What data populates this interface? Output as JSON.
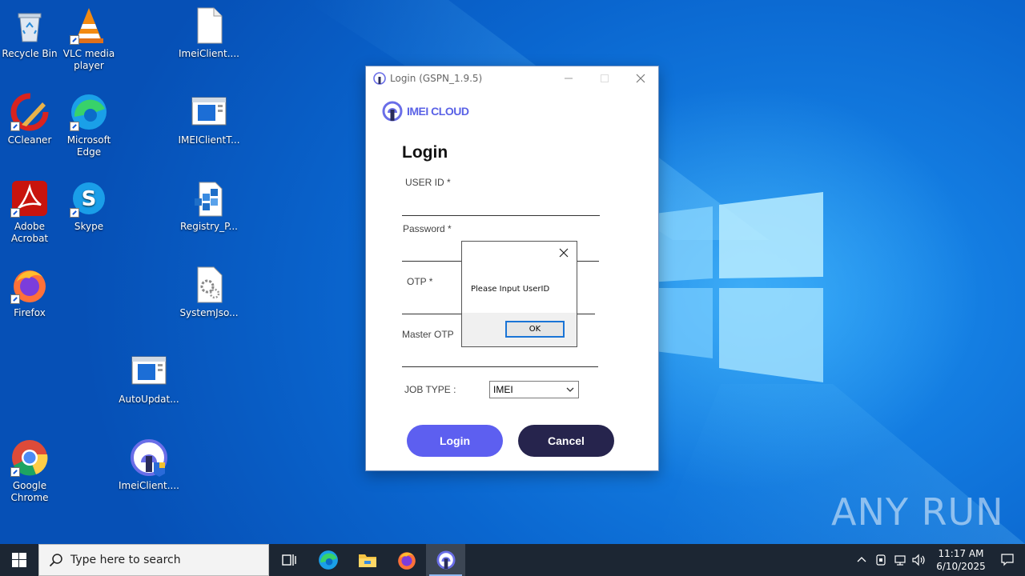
{
  "desktop": {
    "icons": [
      {
        "label": "Recycle Bin",
        "icon": "recycle-bin-icon"
      },
      {
        "label": "VLC media player",
        "icon": "vlc-icon"
      },
      {
        "label": "ImeiClient....",
        "icon": "file-icon"
      },
      {
        "label": "CCleaner",
        "icon": "ccleaner-icon"
      },
      {
        "label": "Microsoft Edge",
        "icon": "edge-icon"
      },
      {
        "label": "IMEIClientT...",
        "icon": "window-app-icon"
      },
      {
        "label": "Adobe Acrobat",
        "icon": "acrobat-icon"
      },
      {
        "label": "Skype",
        "icon": "skype-icon"
      },
      {
        "label": "Registry_P...",
        "icon": "registry-icon"
      },
      {
        "label": "Firefox",
        "icon": "firefox-icon"
      },
      {
        "label": "SystemJso...",
        "icon": "settings-file-icon"
      },
      {
        "label": "AutoUpdat...",
        "icon": "window-app-icon"
      },
      {
        "label": "Google Chrome",
        "icon": "chrome-icon"
      },
      {
        "label": "ImeiClient....",
        "icon": "imei-cloud-icon"
      }
    ],
    "watermark": "ANY RUN"
  },
  "login_window": {
    "title": "Login (GSPN_1.9.5)",
    "brand": "IMEI CLOUD",
    "heading": "Login",
    "fields": {
      "user_id_label": "USER ID *",
      "password_label": "Password *",
      "otp_label": "OTP *",
      "master_otp_label": "Master OTP"
    },
    "job_type_label": "JOB TYPE :",
    "job_type_value": "IMEI",
    "login_button": "Login",
    "cancel_button": "Cancel"
  },
  "message_box": {
    "message": "Please Input UserID",
    "ok_button": "OK"
  },
  "taskbar": {
    "search_placeholder": "Type here to search",
    "time": "11:17 AM",
    "date": "6/10/2025"
  },
  "colors": {
    "accent": "#5d5ff0",
    "cancel": "#26244d",
    "brand": "#5a62e6"
  }
}
